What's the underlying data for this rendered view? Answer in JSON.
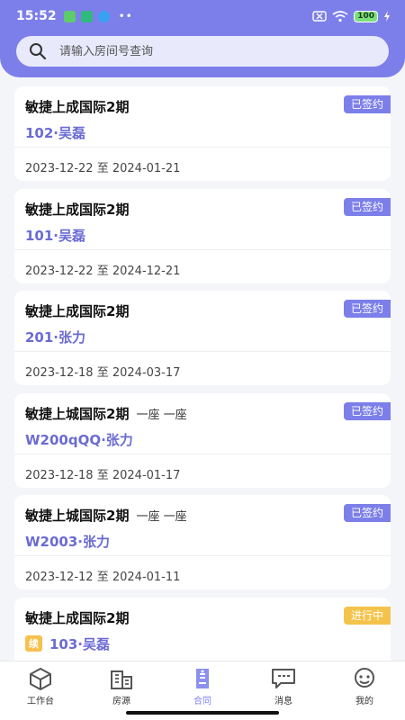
{
  "status_bar": {
    "time": "15:52",
    "battery": "100"
  },
  "search": {
    "placeholder": "请输入房间号查询",
    "value": ""
  },
  "contracts": [
    {
      "project": "敏捷上成国际2期",
      "extra": "",
      "room": "102·吴磊",
      "renew": "",
      "status": "已签约",
      "status_type": "signed",
      "start": "2023-12-22",
      "sep": "至",
      "end": "2024-01-21"
    },
    {
      "project": "敏捷上成国际2期",
      "extra": "",
      "room": "101·吴磊",
      "renew": "",
      "status": "已签约",
      "status_type": "signed",
      "start": "2023-12-22",
      "sep": "至",
      "end": "2024-12-21"
    },
    {
      "project": "敏捷上成国际2期",
      "extra": "",
      "room": "201·张力",
      "renew": "",
      "status": "已签约",
      "status_type": "signed",
      "start": "2023-12-18",
      "sep": "至",
      "end": "2024-03-17"
    },
    {
      "project": "敏捷上城国际2期",
      "extra": "一座 一座",
      "room": "W200qQQ·张力",
      "renew": "",
      "status": "已签约",
      "status_type": "signed",
      "start": "2023-12-18",
      "sep": "至",
      "end": "2024-01-17"
    },
    {
      "project": "敏捷上城国际2期",
      "extra": "一座 一座",
      "room": "W2003·张力",
      "renew": "",
      "status": "已签约",
      "status_type": "signed",
      "start": "2023-12-12",
      "sep": "至",
      "end": "2024-01-11"
    },
    {
      "project": "敏捷上成国际2期",
      "extra": "",
      "room": "103·吴磊",
      "renew": "续",
      "status": "进行中",
      "status_type": "progress",
      "start": "",
      "sep": "",
      "end": ""
    }
  ],
  "tabs": [
    {
      "label": "工作台",
      "icon": "workbench-icon"
    },
    {
      "label": "房源",
      "icon": "building-icon"
    },
    {
      "label": "合同",
      "icon": "contract-icon"
    },
    {
      "label": "消息",
      "icon": "message-icon"
    },
    {
      "label": "我的",
      "icon": "profile-icon"
    }
  ],
  "active_tab": "合同",
  "colors": {
    "accent": "#7c7fe9",
    "progress": "#f4c34b",
    "renew": "#f6c14c"
  }
}
